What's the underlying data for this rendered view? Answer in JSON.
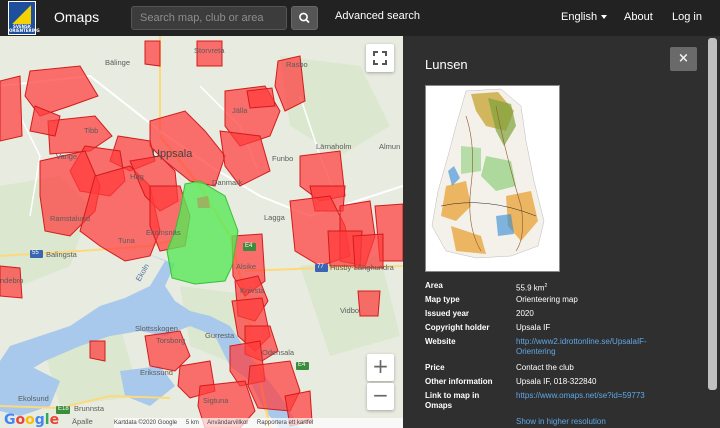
{
  "navbar": {
    "logo_text": "SVENSK ORIENTERING",
    "brand": "Omaps",
    "search_placeholder": "Search map, club or area",
    "advanced_search": "Advanced search",
    "language": "English",
    "about": "About",
    "login": "Log in"
  },
  "map": {
    "labels": {
      "storvreta": "Storvreta",
      "rasbo": "Rasbo",
      "balinge": "Bälinge",
      "jalla": "Jälla",
      "tibble": "Tibb",
      "vange": "Vange",
      "uppsala": "Uppsala",
      "fumbo": "Funbo",
      "lannaholm": "Lärnaholm",
      "almunge": "Almun",
      "danmark": "Danmark",
      "hag": "Hag",
      "ramstalund": "Ramstalund",
      "lagga": "Lagga",
      "balingsta": "Balingsta",
      "tuna": "Tuna",
      "ekolnsnaes": "Ekolnsnäs",
      "knivsta": "Knivsta",
      "alsike": "Alsike",
      "husby": "Husby-Långhundra",
      "ndebro": "ndebro",
      "slottsskogen": "Slottsskogen",
      "torsborg": "Torsborg",
      "gurresta": "Gurresta",
      "eriksund": "Erikssund",
      "odensala": "Odensala",
      "vidbo": "Vidbo",
      "ekolsund": "Ekolsund",
      "brunnsta": "Brunnsta",
      "apalle": "Äpalle",
      "sigtuna": "Sigtuna",
      "ekoln_water": "Ekoln"
    },
    "road_shields": [
      "55",
      "E4",
      "77",
      "E4",
      "E18"
    ],
    "google": "Google",
    "attribution": [
      "Kartdata ©2020 Google",
      "5 km",
      "Användarvillkor",
      "Rapportera ett kartfel"
    ],
    "zoom_in": "+",
    "zoom_out": "−",
    "overlay_colors": {
      "club_maps": "#ff3b3b",
      "selected": "#58e858"
    }
  },
  "detail": {
    "title": "Lunsen",
    "close": "×",
    "rows": [
      {
        "label": "Area",
        "value": "55.9 km",
        "sup": "2"
      },
      {
        "label": "Map type",
        "value": "Orienteering map"
      },
      {
        "label": "Issued year",
        "value": "2020"
      },
      {
        "label": "Copyright holder",
        "value": "Upsala IF"
      },
      {
        "label": "Website",
        "link1": "http://www2.idrottonline.se/UpsalaIF-",
        "link2": "Orientering"
      },
      {
        "label": "Price",
        "value": "Contact the club"
      },
      {
        "label": "Other information",
        "value": "Upsala IF, 018-322840"
      },
      {
        "label1": "Link to map in",
        "label2": "Omaps",
        "link": "https://www.omaps.net/se?id=59773"
      }
    ],
    "higher_res": "Show in higher resolution"
  }
}
